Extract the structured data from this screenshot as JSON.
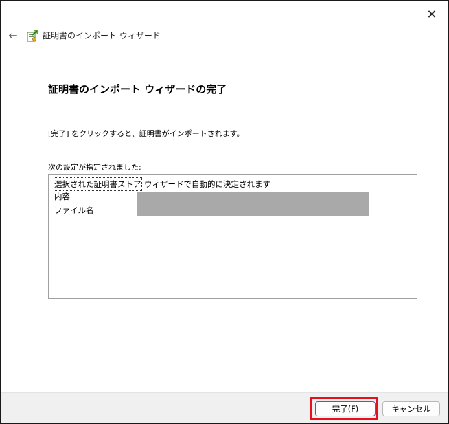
{
  "window": {
    "close_glyph": "✕",
    "back_glyph": "←",
    "title": "証明書のインポート ウィザード"
  },
  "main": {
    "heading": "証明書のインポート ウィザードの完了",
    "instruction": "[完了] をクリックすると、証明書がインポートされます。",
    "settings_label": "次の設定が指定されました:",
    "settings": [
      {
        "key": "選択された証明書ストア",
        "value": "ウィザードで自動的に決定されます"
      },
      {
        "key": "内容",
        "value": ""
      },
      {
        "key": "ファイル名",
        "value": ""
      }
    ]
  },
  "footer": {
    "finish_label": "完了(F)",
    "cancel_label": "キャンセル"
  },
  "colors": {
    "highlight": "#e8101c",
    "redaction": "#a9a9a9",
    "accent": "#2b6ec6"
  },
  "icons": {
    "back": "back-arrow-icon",
    "close": "close-icon",
    "wizard": "certificate-wizard-icon"
  }
}
